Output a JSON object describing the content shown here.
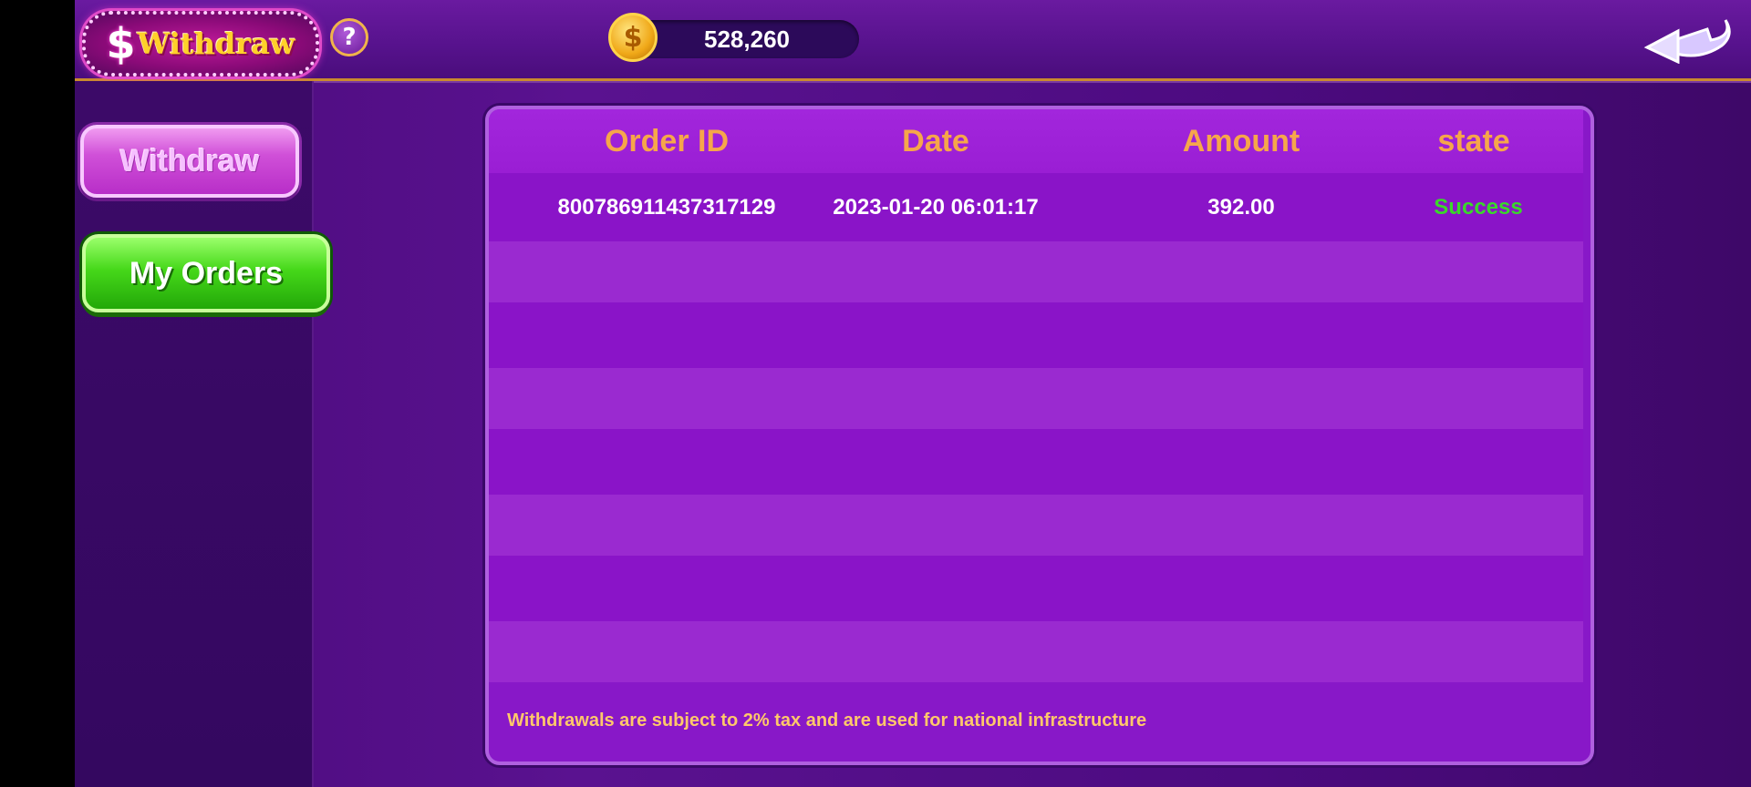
{
  "header": {
    "logo_symbol": "$",
    "logo_text": "Withdraw",
    "help_label": "?",
    "coin_symbol": "$",
    "balance": "528,260",
    "icons": [
      "help-icon",
      "coin-icon",
      "back-arrow-icon"
    ]
  },
  "sidebar": {
    "items": [
      {
        "label": "Withdraw",
        "active": false
      },
      {
        "label": "My Orders",
        "active": true
      }
    ]
  },
  "orders": {
    "columns": [
      "Order ID",
      "Date",
      "Amount",
      "state"
    ],
    "rows": [
      {
        "order_id": "800786911437317129",
        "date": "2023-01-20 06:01:17",
        "amount": "392.00",
        "state": "Success"
      }
    ],
    "note": "Withdrawals are subject to 2% tax and are used for national infrastructure"
  },
  "colors": {
    "header_text": "#f6a64a",
    "success": "#3ad82a",
    "note": "#ffc86a"
  }
}
